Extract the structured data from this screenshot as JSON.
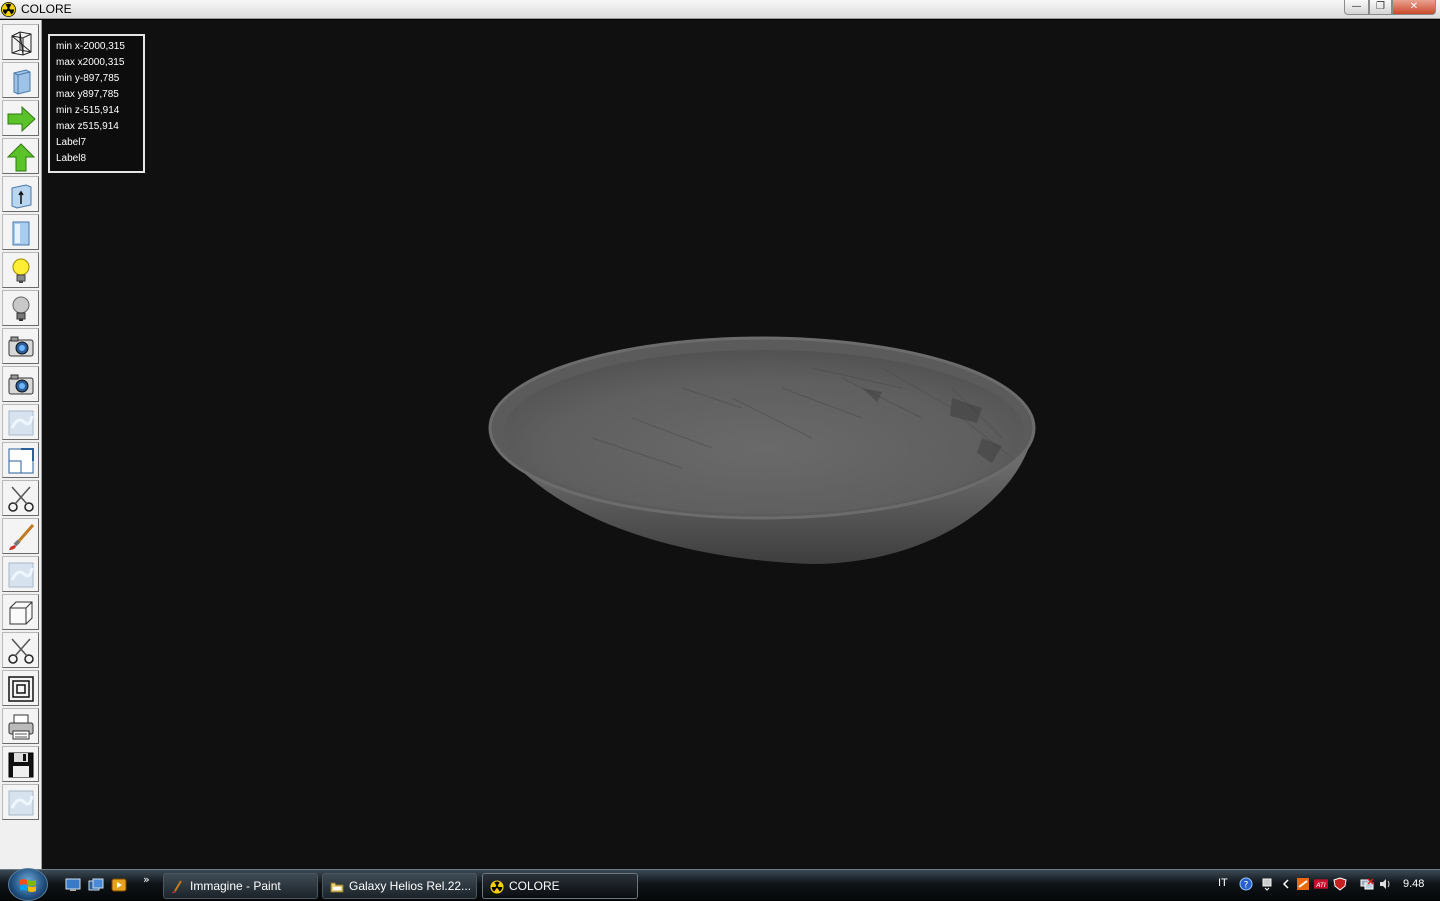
{
  "window": {
    "title": "COLORE",
    "minimize_glyph": "—",
    "maximize_glyph": "❐",
    "close_glyph": "✕"
  },
  "toolbar": {
    "tools": [
      {
        "name": "wireframe-icon"
      },
      {
        "name": "solid-block-icon"
      },
      {
        "name": "arrow-right-icon"
      },
      {
        "name": "arrow-up-icon"
      },
      {
        "name": "box-axis-icon"
      },
      {
        "name": "cylinder-icon"
      },
      {
        "name": "light-on-icon"
      },
      {
        "name": "light-off-icon"
      },
      {
        "name": "camera-icon"
      },
      {
        "name": "camera-alt-icon"
      },
      {
        "name": "texture-icon"
      },
      {
        "name": "split-view-icon"
      },
      {
        "name": "scissors-icon"
      },
      {
        "name": "brush-icon"
      },
      {
        "name": "texture-alt-icon"
      },
      {
        "name": "cube-icon"
      },
      {
        "name": "scissors-alt-icon"
      },
      {
        "name": "concentric-squares-icon"
      },
      {
        "name": "printer-icon"
      },
      {
        "name": "floppy-save-icon"
      },
      {
        "name": "texture-third-icon"
      }
    ]
  },
  "info": {
    "min_x": "min x-2000,315",
    "max_x": "max x2000,315",
    "min_y": "min y-897,785",
    "max_y": "max y897,785",
    "min_z": "min z-515,914",
    "max_z": "max z515,914",
    "label7": "Label7",
    "label8": "Label8"
  },
  "taskbar": {
    "quicklaunch_more": "»",
    "tasks": [
      {
        "label": "Immagine - Paint",
        "icon": "paint-icon"
      },
      {
        "label": "Galaxy Helios  Rel.22...",
        "icon": "folder-icon"
      },
      {
        "label": "COLORE",
        "icon": "radiation-icon"
      }
    ],
    "tray": {
      "language": "IT",
      "clock": "9.48"
    }
  }
}
